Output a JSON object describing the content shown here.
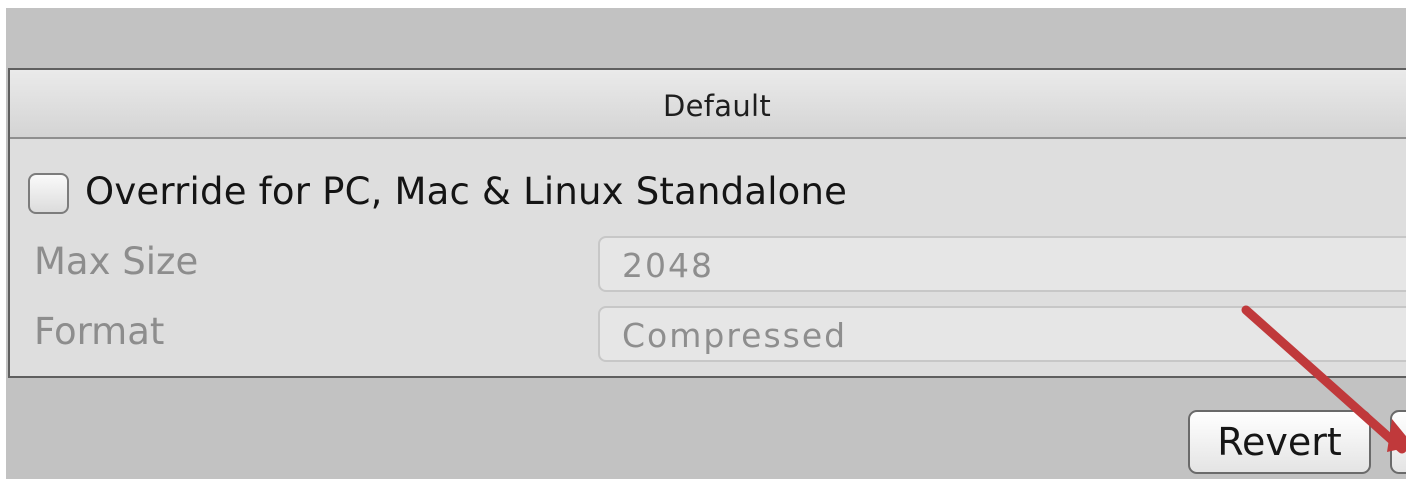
{
  "tabs": {
    "default_label": "Default"
  },
  "override": {
    "label": "Override for PC, Mac & Linux Standalone",
    "checked": false
  },
  "fields": {
    "max_size": {
      "label": "Max Size",
      "value": "2048"
    },
    "format": {
      "label": "Format",
      "value": "Compressed"
    }
  },
  "buttons": {
    "revert_label": "Revert",
    "apply_label": ""
  },
  "annotation": {
    "arrow_color": "#c0393b"
  }
}
